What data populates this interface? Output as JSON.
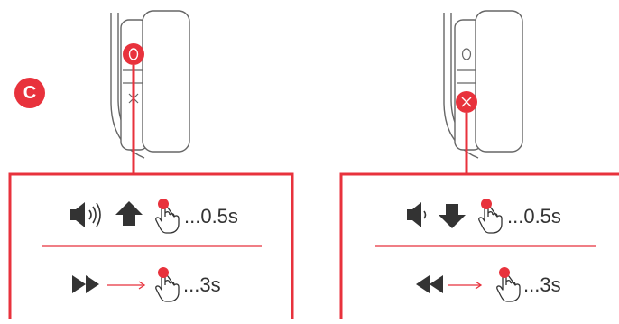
{
  "step_label": "C",
  "colors": {
    "accent": "#e8323c",
    "line": "#666666",
    "icon": "#333333"
  },
  "panels": [
    {
      "id": "left",
      "highlighted_button": "circle",
      "rows": [
        {
          "icon": "volume-up-icon",
          "arrow": "arrow-up-icon",
          "duration": "...0.5s"
        },
        {
          "icon": "fast-forward-icon",
          "arrow": "right-arrow-icon",
          "duration": "...3s"
        }
      ]
    },
    {
      "id": "right",
      "highlighted_button": "x",
      "rows": [
        {
          "icon": "volume-down-icon",
          "arrow": "arrow-down-icon",
          "duration": "...0.5s"
        },
        {
          "icon": "rewind-icon",
          "arrow": "right-arrow-icon",
          "duration": "...3s"
        }
      ]
    }
  ]
}
